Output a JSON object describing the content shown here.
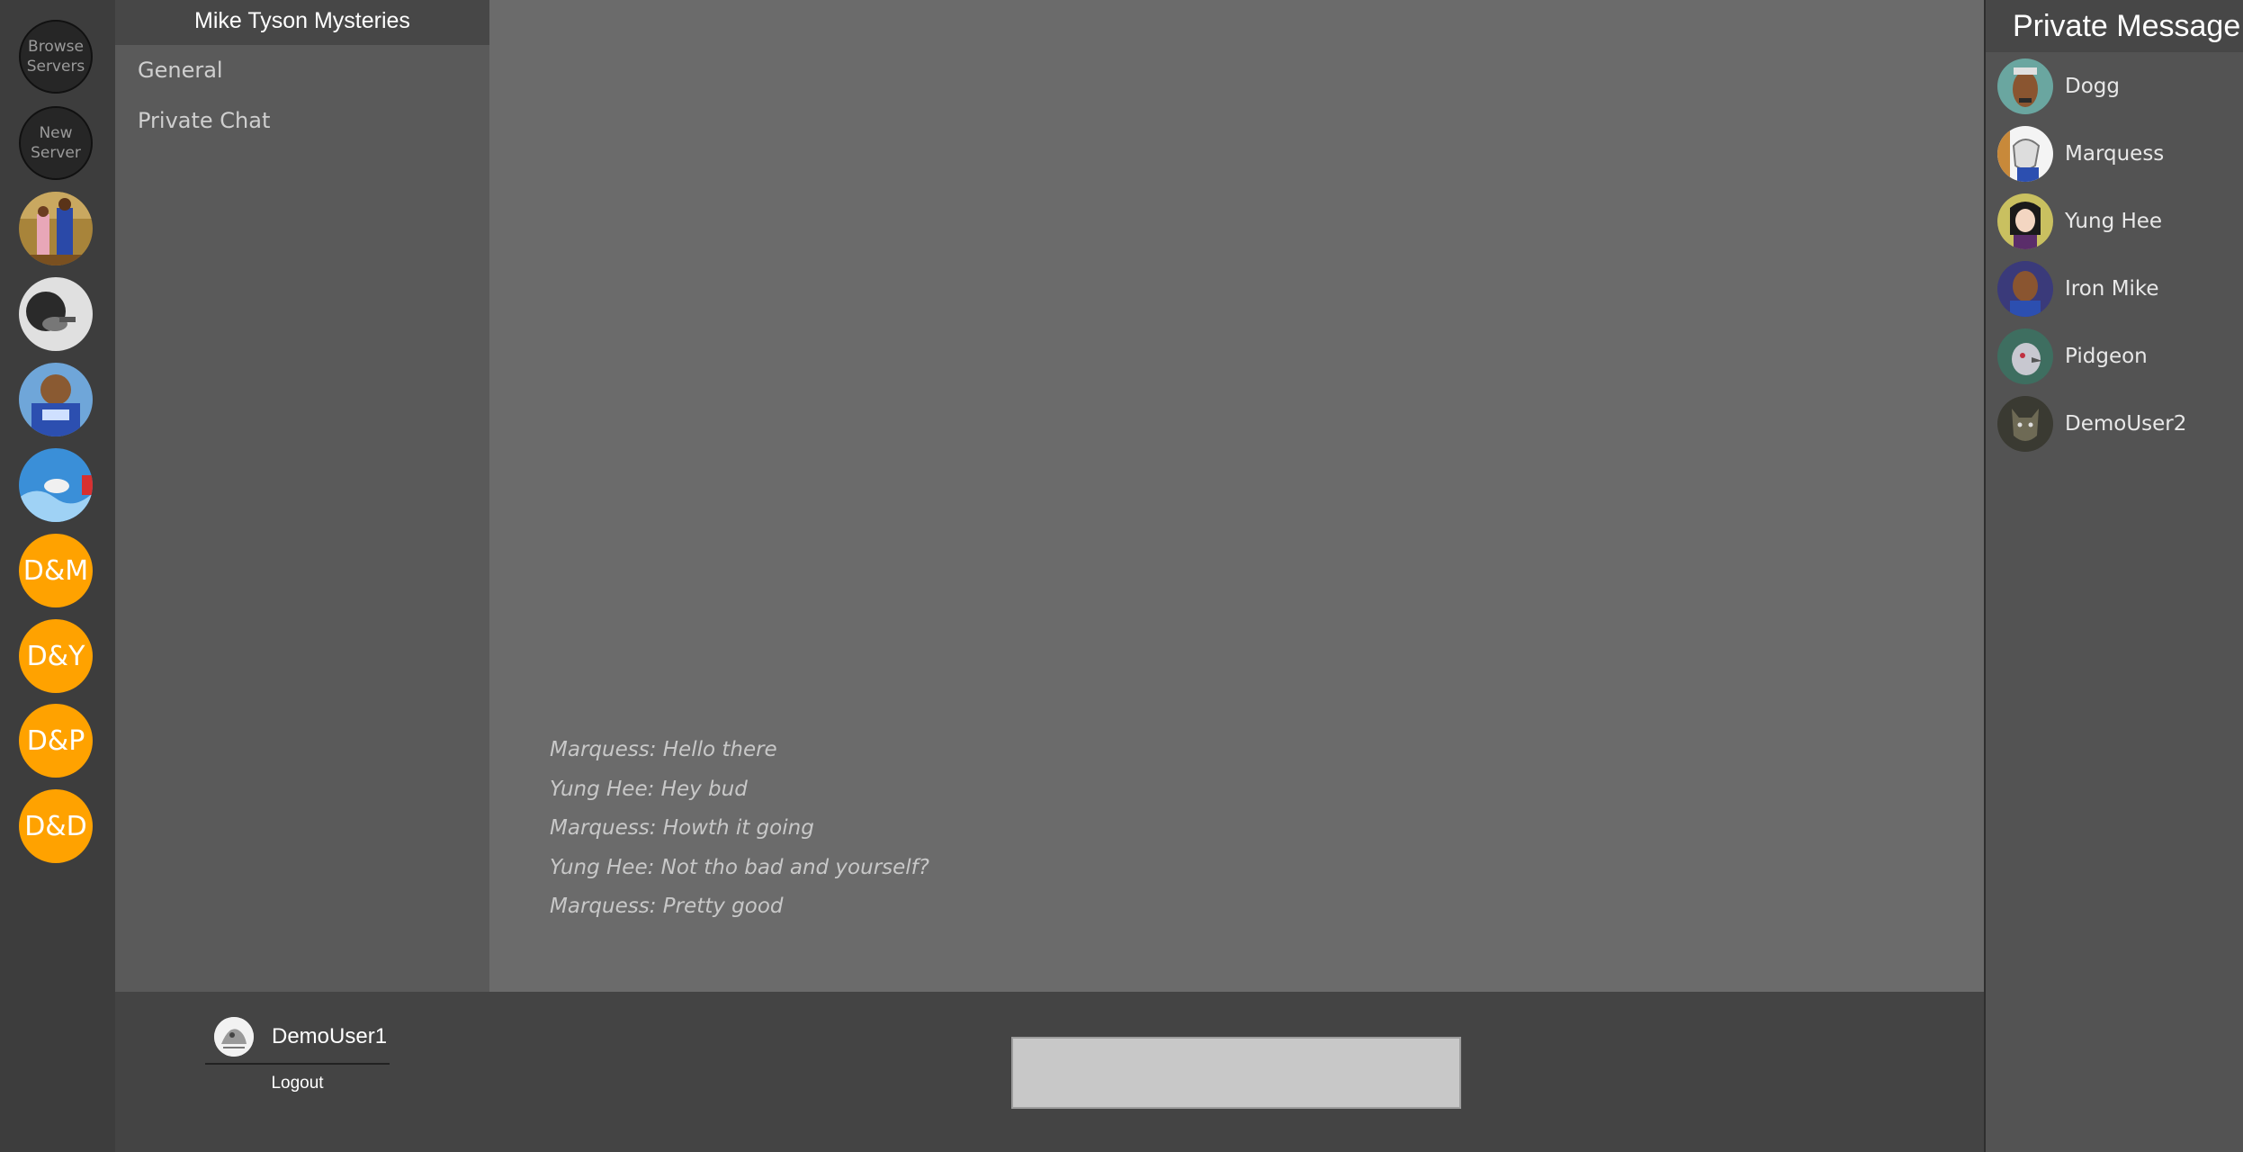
{
  "server_rail": {
    "browse_label": "Browse Servers",
    "new_label": "New Server",
    "initial_servers": [
      "D&M",
      "D&Y",
      "D&P",
      "D&D"
    ],
    "accent_color": "#ffa200"
  },
  "channel_panel": {
    "server_name": "Mike Tyson Mysteries",
    "channels": [
      "General",
      "Private Chat"
    ]
  },
  "messages": [
    "Marquess: Hello there",
    "Yung Hee: Hey bud",
    "Marquess: Howth it going",
    "Yung Hee: Not tho bad and yourself?",
    "Marquess: Pretty good"
  ],
  "current_user": {
    "name": "DemoUser1",
    "logout_label": "Logout"
  },
  "composer": {
    "placeholder": ""
  },
  "private_messages": {
    "title": "Private Message:",
    "users": [
      "Dogg",
      "Marquess",
      "Yung Hee",
      "Iron Mike",
      "Pidgeon",
      "DemoUser2"
    ]
  }
}
